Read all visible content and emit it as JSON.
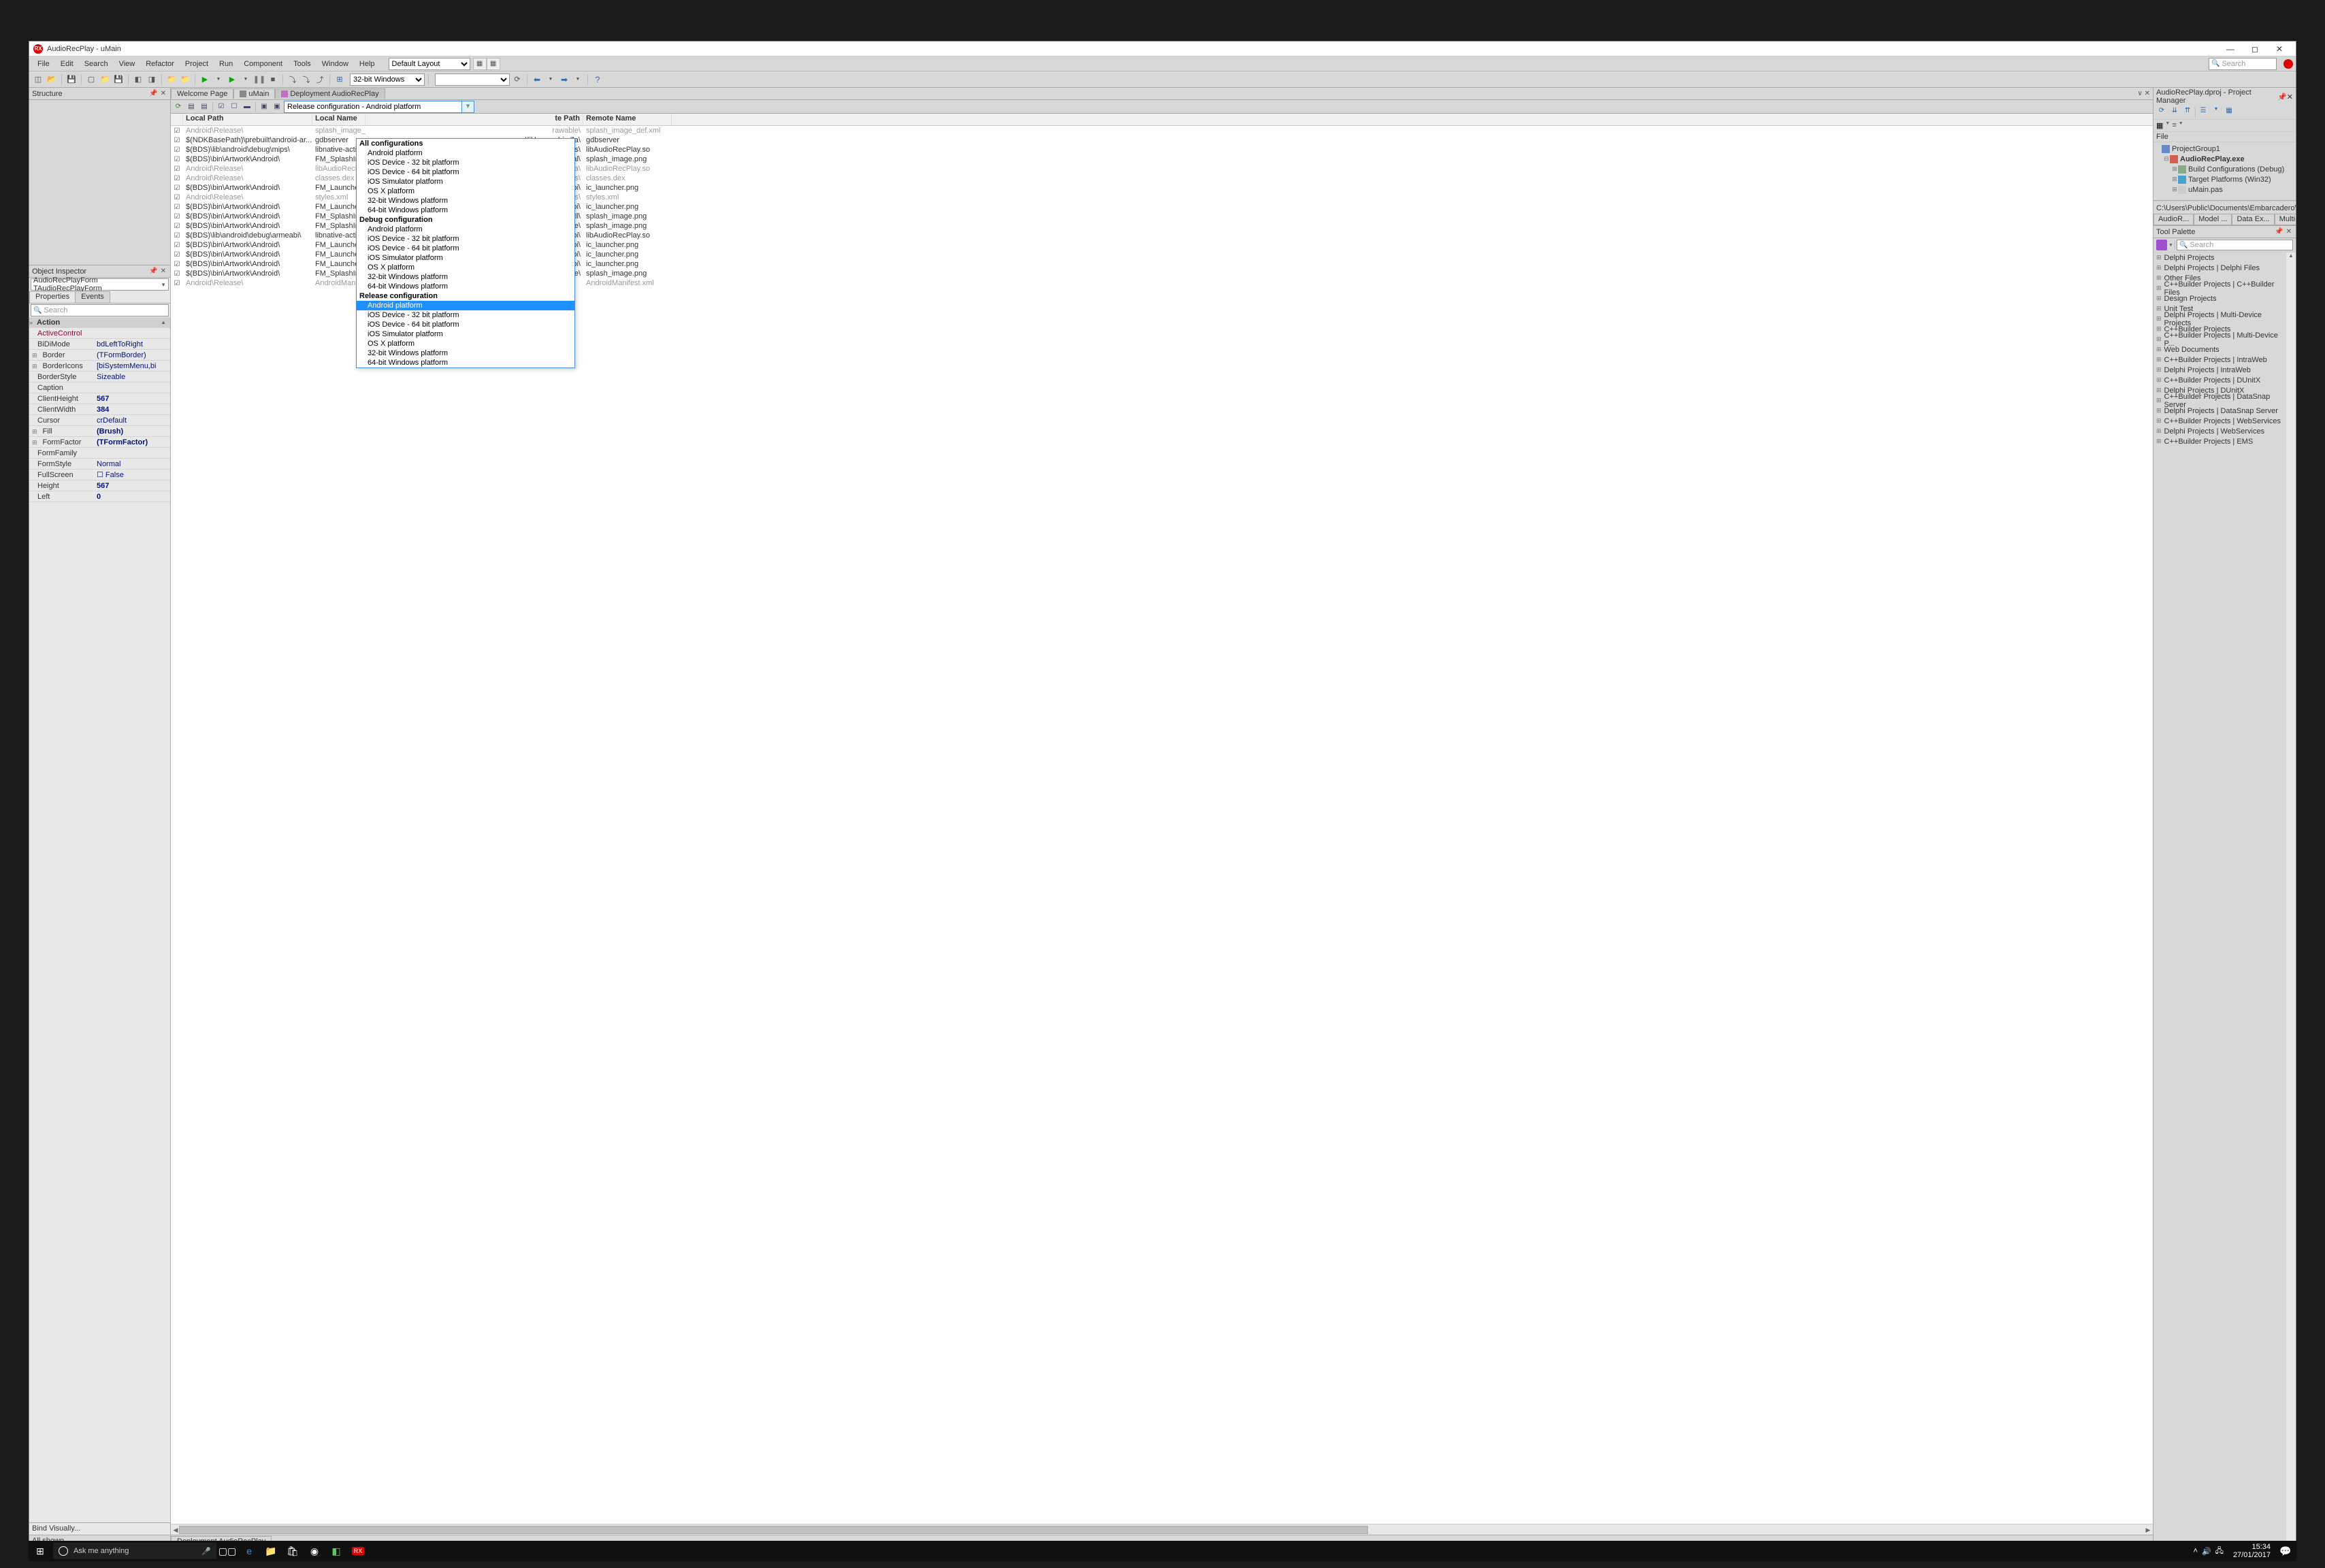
{
  "window": {
    "title": "AudioRecPlay - uMain"
  },
  "menus": [
    "File",
    "Edit",
    "Search",
    "View",
    "Refactor",
    "Project",
    "Run",
    "Component",
    "Tools",
    "Window",
    "Help"
  ],
  "layout_selector": "Default Layout",
  "top_search": {
    "placeholder": "Search"
  },
  "target_platform": "32-bit Windows",
  "structure": {
    "title": "Structure"
  },
  "inspector": {
    "title": "Object Inspector",
    "object": "AudioRecPlayForm  TAudioRecPlayForm",
    "tabs": [
      "Properties",
      "Events"
    ],
    "search_placeholder": "Search",
    "header": "Action",
    "props": [
      {
        "k": "ActiveControl",
        "v": "",
        "style": "red"
      },
      {
        "k": "BiDiMode",
        "v": "bdLeftToRight"
      },
      {
        "k": "Border",
        "v": "(TFormBorder)",
        "expand": true
      },
      {
        "k": "BorderIcons",
        "v": "[biSystemMenu,bi",
        "expand": true
      },
      {
        "k": "BorderStyle",
        "v": "Sizeable"
      },
      {
        "k": "Caption",
        "v": ""
      },
      {
        "k": "ClientHeight",
        "v": "567",
        "bold": true
      },
      {
        "k": "ClientWidth",
        "v": "384",
        "bold": true
      },
      {
        "k": "Cursor",
        "v": "crDefault"
      },
      {
        "k": "Fill",
        "v": "(Brush)",
        "bold": true,
        "expand": true
      },
      {
        "k": "FormFactor",
        "v": "(TFormFactor)",
        "bold": true,
        "expand": true
      },
      {
        "k": "FormFamily",
        "v": ""
      },
      {
        "k": "FormStyle",
        "v": "Normal"
      },
      {
        "k": "FullScreen",
        "v": "☐ False"
      },
      {
        "k": "Height",
        "v": "567",
        "bold": true
      },
      {
        "k": "Left",
        "v": "0",
        "bold": true
      }
    ],
    "footer": "Bind Visually...",
    "status": "All shown"
  },
  "editor_tabs": [
    {
      "label": "Welcome Page"
    },
    {
      "label": "uMain"
    },
    {
      "label": "Deployment AudioRecPlay",
      "active": true
    }
  ],
  "deploy_config": "Release configuration - Android platform",
  "deploy_columns": [
    "Local Path",
    "Local Name",
    "",
    "te Path",
    "Remote Name"
  ],
  "deploy_rows": [
    {
      "lp": "Android\\Release\\",
      "ln": "splash_image_d",
      "rp": "rawable\\",
      "rn": "splash_image_def.xml",
      "dim": true
    },
    {
      "lp": "$(NDKBasePath)\\prebuilt\\android-ar...",
      "ln": "gdbserver",
      "rp": "y\\lib\\armeabi-v7a\\",
      "rn": "gdbserver"
    },
    {
      "lp": "$(BDS)\\lib\\android\\debug\\mips\\",
      "ln": "libnative-activit",
      "rp": "y\\lib\\mips\\",
      "rn": "libAudioRecPlay.so"
    },
    {
      "lp": "$(BDS)\\bin\\Artwork\\Android\\",
      "ln": "FM_SplashImag",
      "rp": "rawable-normal\\",
      "rn": "splash_image.png"
    },
    {
      "lp": "Android\\Release\\",
      "ln": "libAudioRecPla",
      "rp": "y\\lib\\armeabi-v7a\\",
      "rn": "libAudioRecPlay.so",
      "dim": true
    },
    {
      "lp": "Android\\Release\\",
      "ln": "classes.dex",
      "rp": "es\\",
      "rn": "classes.dex",
      "dim": true
    },
    {
      "lp": "$(BDS)\\bin\\Artwork\\Android\\",
      "ln": "FM_LauncherIc",
      "rp": "rawable-mdpi\\",
      "rn": "ic_launcher.png"
    },
    {
      "lp": "Android\\Release\\",
      "ln": "styles.xml",
      "rp": "alues\\",
      "rn": "styles.xml",
      "dim": true
    },
    {
      "lp": "$(BDS)\\bin\\Artwork\\Android\\",
      "ln": "FM_LauncherIc",
      "rp": "rawable-ldpi\\",
      "rn": "ic_launcher.png"
    },
    {
      "lp": "$(BDS)\\bin\\Artwork\\Android\\",
      "ln": "FM_SplashImag",
      "rp": "rawable-small\\",
      "rn": "splash_image.png"
    },
    {
      "lp": "$(BDS)\\bin\\Artwork\\Android\\",
      "ln": "FM_SplashImag",
      "rp": "rawable-xlarge\\",
      "rn": "splash_image.png"
    },
    {
      "lp": "$(BDS)\\lib\\android\\debug\\armeabi\\",
      "ln": "libnative-activit",
      "rp": "y\\lib\\armeabi\\",
      "rn": "libAudioRecPlay.so"
    },
    {
      "lp": "$(BDS)\\bin\\Artwork\\Android\\",
      "ln": "FM_LauncherIc",
      "rp": "rawable-hdpi\\",
      "rn": "ic_launcher.png"
    },
    {
      "lp": "$(BDS)\\bin\\Artwork\\Android\\",
      "ln": "FM_LauncherIc",
      "rp": "rawable-xxhdpi\\",
      "rn": "ic_launcher.png"
    },
    {
      "lp": "$(BDS)\\bin\\Artwork\\Android\\",
      "ln": "FM_LauncherIc",
      "rp": "rawable-xhdpi\\",
      "rn": "ic_launcher.png"
    },
    {
      "lp": "$(BDS)\\bin\\Artwork\\Android\\",
      "ln": "FM_SplashImag",
      "rp": "rawable-large\\",
      "rn": "splash_image.png"
    },
    {
      "lp": "Android\\Release\\",
      "ln": "AndroidManifes",
      "rp": "",
      "rn": "AndroidManifest.xml",
      "dim": true
    }
  ],
  "dropdown": {
    "groups": [
      {
        "title": "All configurations",
        "items": [
          "Android platform",
          "iOS Device - 32 bit platform",
          "iOS Device - 64 bit platform",
          "iOS Simulator platform",
          "OS X platform",
          "32-bit Windows platform",
          "64-bit Windows platform"
        ]
      },
      {
        "title": "Debug configuration",
        "items": [
          "Android platform",
          "iOS Device - 32 bit platform",
          "iOS Device - 64 bit platform",
          "iOS Simulator platform",
          "OS X platform",
          "32-bit Windows platform",
          "64-bit Windows platform"
        ]
      },
      {
        "title": "Release configuration",
        "items": [
          "Android platform",
          "iOS Device - 32 bit platform",
          "iOS Device - 64 bit platform",
          "iOS Simulator platform",
          "OS X platform",
          "32-bit Windows platform",
          "64-bit Windows platform"
        ],
        "selected": 0
      }
    ]
  },
  "bottom_tab": "Deployment AudioRecPlay",
  "project_manager": {
    "title": "AudioRecPlay.dproj - Project Manager",
    "file_label": "File",
    "tree": [
      {
        "label": "ProjectGroup1",
        "indent": 0,
        "twist": "",
        "icon": "#6688cc"
      },
      {
        "label": "AudioRecPlay.exe",
        "indent": 1,
        "twist": "⊟",
        "bold": true,
        "icon": "#d06050"
      },
      {
        "label": "Build Configurations (Debug)",
        "indent": 2,
        "twist": "⊞",
        "icon": "#8a8"
      },
      {
        "label": "Target Platforms (Win32)",
        "indent": 2,
        "twist": "⊞",
        "icon": "#48a0d0"
      },
      {
        "label": "uMain.pas",
        "indent": 2,
        "twist": "⊞",
        "icon": "#ccc"
      }
    ],
    "path": "C:\\Users\\Public\\Documents\\Embarcadero\\St",
    "subtabs": [
      "AudioR...",
      "Model ...",
      "Data Ex...",
      "Multi-..."
    ]
  },
  "palette": {
    "title": "Tool Palette",
    "search_placeholder": "Search",
    "cats": [
      "Delphi Projects",
      "Delphi Projects | Delphi Files",
      "Other Files",
      "C++Builder Projects | C++Builder Files",
      "Design Projects",
      "Unit Test",
      "Delphi Projects | Multi-Device Projects",
      "C++Builder Projects",
      "C++Builder Projects | Multi-Device P...",
      "Web Documents",
      "C++Builder Projects | IntraWeb",
      "Delphi Projects | IntraWeb",
      "C++Builder Projects | DUnitX",
      "Delphi Projects | DUnitX",
      "C++Builder Projects | DataSnap Server",
      "Delphi Projects | DataSnap Server",
      "C++Builder Projects | WebServices",
      "Delphi Projects | WebServices",
      "C++Builder Projects | EMS"
    ]
  },
  "taskbar": {
    "cortana": "Ask me anything",
    "time": "15:34",
    "date": "27/01/2017"
  }
}
